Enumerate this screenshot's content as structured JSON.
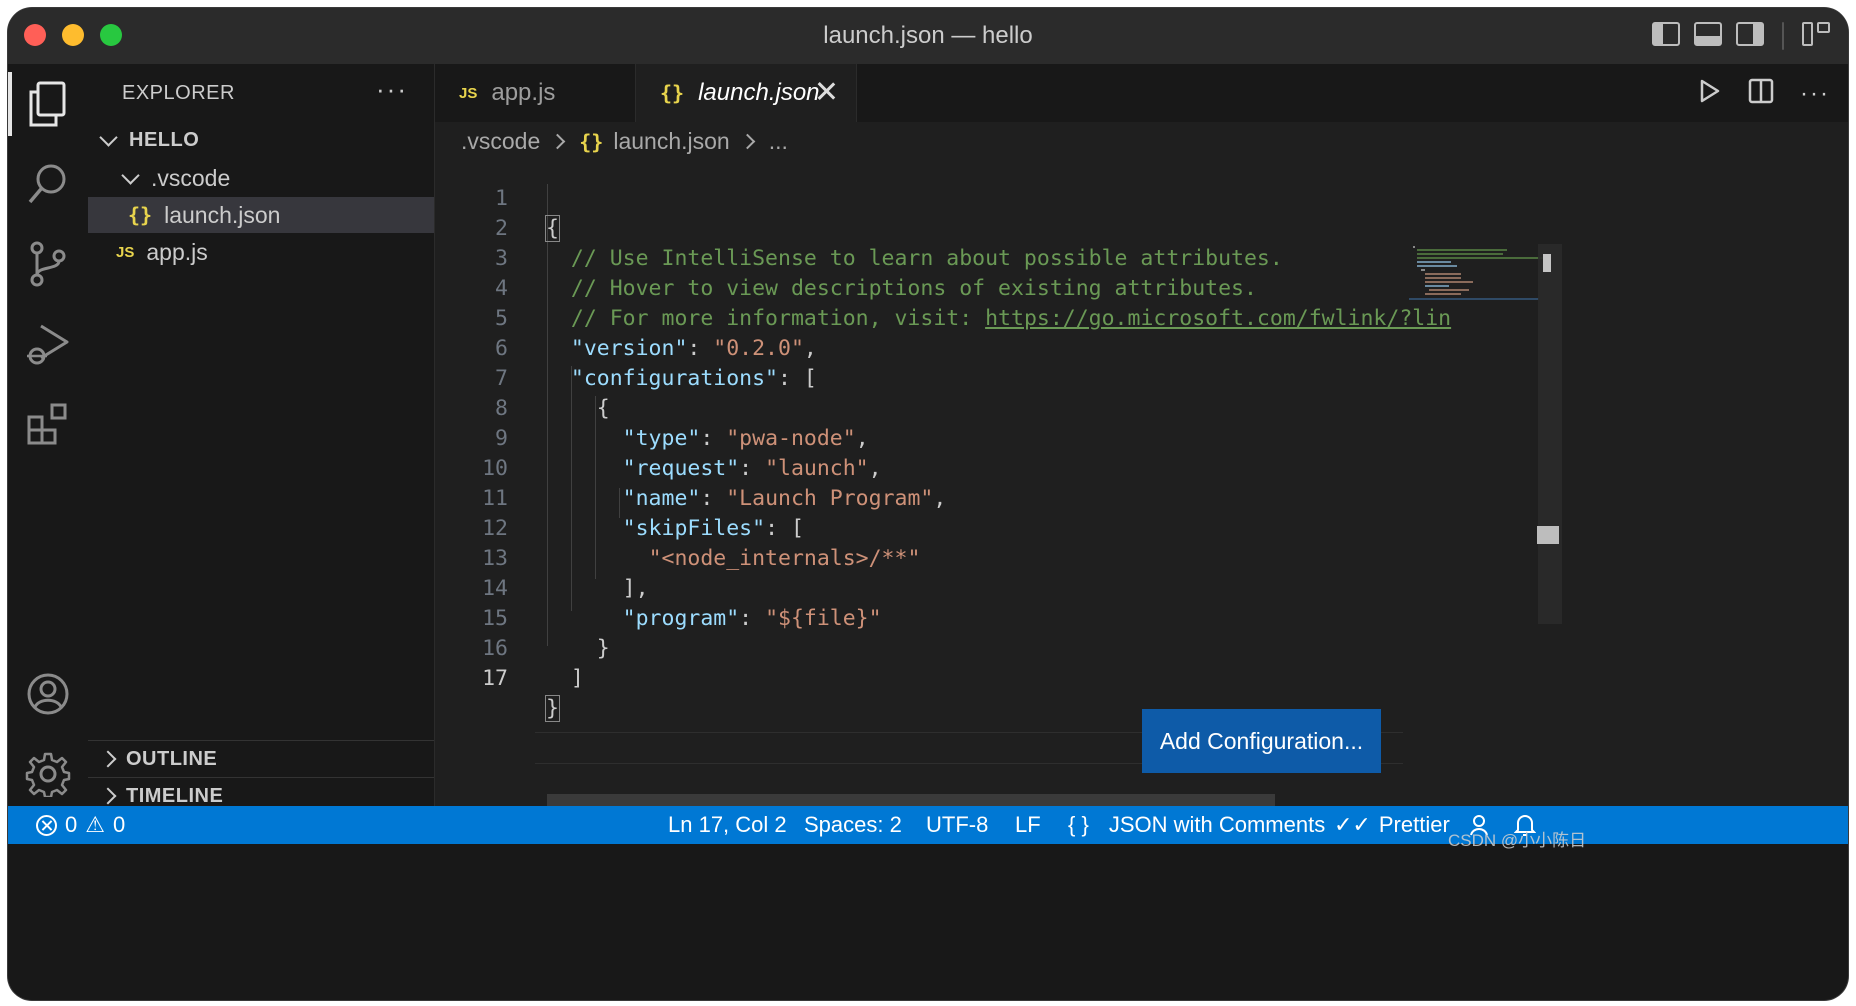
{
  "window": {
    "title": "launch.json — hello"
  },
  "activity_bar": {
    "items": [
      "explorer-icon",
      "search-icon",
      "source-control-icon",
      "run-debug-icon",
      "extensions-icon"
    ],
    "bottom": [
      "account-icon",
      "settings-gear-icon"
    ]
  },
  "sidebar": {
    "header": "EXPLORER",
    "more": "···",
    "root": "HELLO",
    "folder": ".vscode",
    "files": [
      {
        "icon": "{}",
        "name": "launch.json"
      },
      {
        "icon": "JS",
        "name": "app.js"
      }
    ],
    "sections": [
      "OUTLINE",
      "TIMELINE"
    ]
  },
  "tabs": [
    {
      "icon": "JS",
      "label": "app.js"
    },
    {
      "icon": "{}",
      "label": "launch.json"
    }
  ],
  "breadcrumb": [
    ".vscode",
    "{}",
    "launch.json",
    "..."
  ],
  "editor": {
    "line_numbers": [
      "1",
      "2",
      "3",
      "4",
      "5",
      "6",
      "7",
      "8",
      "9",
      "10",
      "11",
      "12",
      "13",
      "14",
      "15",
      "16",
      "17"
    ],
    "lines": {
      "l1": "{",
      "l2": "  // Use IntelliSense to learn about possible attributes.",
      "l3": "  // Hover to view descriptions of existing attributes.",
      "l4_cmt": "  // For more information, visit: ",
      "l4_link": "https://go.microsoft.com/fwlink/?lin",
      "l5_key": "\"version\"",
      "l5_val": "\"0.2.0\"",
      "l6_key": "\"configurations\"",
      "l7": "{",
      "l8_key": "\"type\"",
      "l8_val": "\"pwa-node\"",
      "l9_key": "\"request\"",
      "l9_val": "\"launch\"",
      "l10_key": "\"name\"",
      "l10_val": "\"Launch Program\"",
      "l11_key": "\"skipFiles\"",
      "l12_val": "\"<node_internals>/**\"",
      "l13": "],",
      "l14_key": "\"program\"",
      "l14_val": "\"${file}\"",
      "l15": "}",
      "l16": "]",
      "l17": "}"
    },
    "add_configuration": "Add Configuration..."
  },
  "statusbar": {
    "errors": "0",
    "warnings": "0",
    "position": "Ln 17, Col 2",
    "spaces": "Spaces: 2",
    "encoding": "UTF-8",
    "eol": "LF",
    "lang_icon": "{ }",
    "language": "JSON with Comments",
    "formatter": "Prettier",
    "watermark": "CSDN @小小陈日"
  },
  "colors": {
    "accent": "#0078d4",
    "button": "#0e5ba8",
    "string": "#ce9178",
    "key": "#9cdcfe",
    "comment": "#6a9955"
  }
}
